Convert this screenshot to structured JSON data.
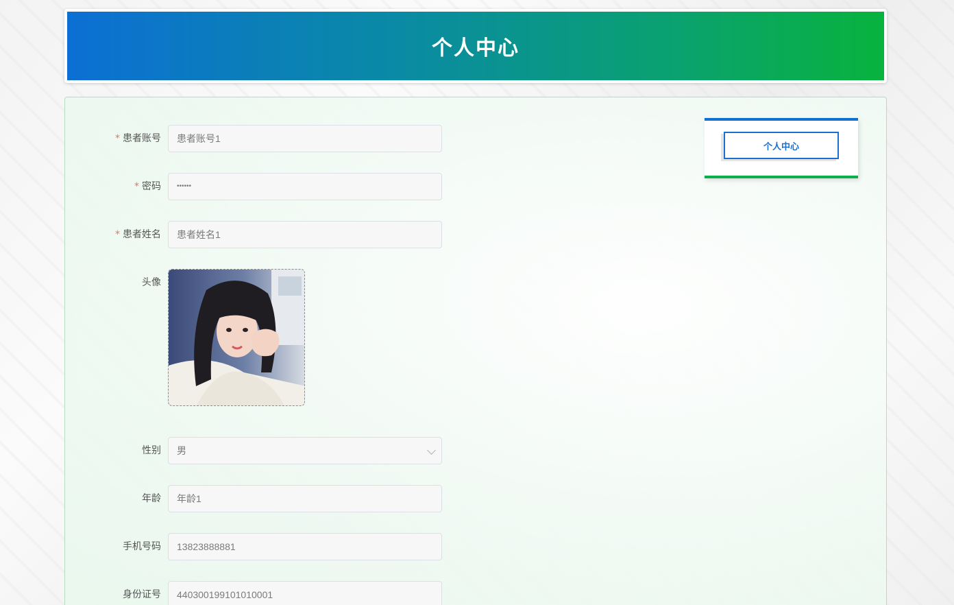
{
  "header": {
    "title": "个人中心"
  },
  "form": {
    "account": {
      "label": "患者账号",
      "value": "患者账号1",
      "required": true
    },
    "password": {
      "label": "密码",
      "value": "••••••",
      "required": true
    },
    "name": {
      "label": "患者姓名",
      "value": "患者姓名1",
      "required": true
    },
    "avatar": {
      "label": "头像"
    },
    "gender": {
      "label": "性别",
      "value": "男"
    },
    "age": {
      "label": "年龄",
      "value": "年龄1"
    },
    "phone": {
      "label": "手机号码",
      "value": "13823888881"
    },
    "id_number": {
      "label": "身份证号",
      "value": "440300199101010001"
    }
  },
  "sidebar": {
    "button_label": "个人中心"
  },
  "colors": {
    "header_gradient_start": "#0c6fd4",
    "header_gradient_end": "#08b33d",
    "required_mark": "#f56c6c",
    "sidebar_button": "#1a6fd0"
  }
}
